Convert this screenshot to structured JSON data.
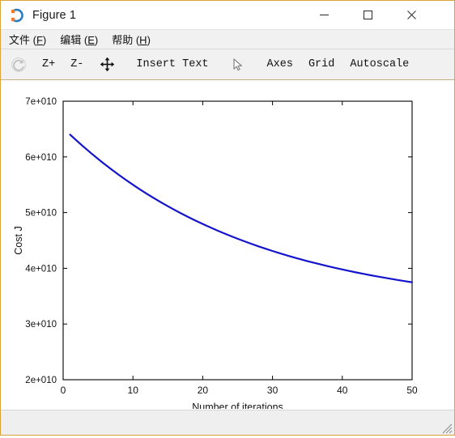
{
  "window": {
    "title": "Figure 1",
    "icon": "octave-logo-icon",
    "border_color": "#dba33a",
    "controls": {
      "minimize": "–",
      "maximize": "□",
      "close": "✕"
    }
  },
  "menubar": {
    "items": [
      {
        "label": "文件 (F)",
        "text": "文件 (",
        "accel": "F",
        "tail": ")",
        "name": "menu-file"
      },
      {
        "label": "编辑 (E)",
        "text": "编辑 (",
        "accel": "E",
        "tail": ")",
        "name": "menu-edit"
      },
      {
        "label": "帮助 (H)",
        "text": "帮助 (",
        "accel": "H",
        "tail": ")",
        "name": "menu-help"
      }
    ]
  },
  "toolbar": {
    "autoscale_icon": "reset-rotate-icon",
    "zoom_in": "Z+",
    "zoom_out": "Z-",
    "pan_icon": "pan-move-icon",
    "insert_text": "Insert Text",
    "select_icon": "cursor-pointer-icon",
    "axes": "Axes",
    "grid": "Grid",
    "autoscale": "Autoscale"
  },
  "chart_data": {
    "type": "line",
    "title": "",
    "xlabel": "Number of iterations",
    "ylabel": "Cost J",
    "xlim": [
      0,
      50
    ],
    "ylim": [
      20000000000,
      70000000000
    ],
    "xticks": [
      0,
      10,
      20,
      30,
      40,
      50
    ],
    "xticklabels": [
      "0",
      "10",
      "20",
      "30",
      "40",
      "50"
    ],
    "yticks": [
      20000000000,
      30000000000,
      40000000000,
      50000000000,
      60000000000,
      70000000000
    ],
    "yticklabels": [
      "2e+010",
      "3e+010",
      "4e+010",
      "5e+010",
      "6e+010",
      "7e+010"
    ],
    "grid": false,
    "legend": null,
    "series": [
      {
        "name": "Cost J",
        "color": "#1414cc",
        "linewidth": 2.2,
        "x": [
          1,
          2,
          3,
          4,
          5,
          6,
          7,
          8,
          9,
          10,
          11,
          12,
          13,
          14,
          15,
          16,
          17,
          18,
          19,
          20,
          21,
          22,
          23,
          24,
          25,
          26,
          27,
          28,
          29,
          30,
          31,
          32,
          33,
          34,
          35,
          36,
          37,
          38,
          39,
          40,
          41,
          42,
          43,
          44,
          45,
          46,
          47,
          48,
          49,
          50
        ],
        "y": [
          64000000000,
          62850000000,
          61740000000,
          60670000000,
          59640000000,
          58640000000,
          57680000000,
          56750000000,
          55860000000,
          55000000000,
          54170000000,
          53370000000,
          52600000000,
          51860000000,
          51150000000,
          50460000000,
          49800000000,
          49160000000,
          48550000000,
          47960000000,
          47390000000,
          46840000000,
          46310000000,
          45800000000,
          45310000000,
          44840000000,
          44380000000,
          43940000000,
          43520000000,
          43110000000,
          42720000000,
          42340000000,
          41980000000,
          41630000000,
          41290000000,
          40970000000,
          40660000000,
          40360000000,
          40070000000,
          39790000000,
          39520000000,
          39260000000,
          39010000000,
          38770000000,
          38540000000,
          38320000000,
          38100000000,
          37890000000,
          37690000000,
          37500000000
        ]
      }
    ]
  },
  "statusbar": {
    "text": "",
    "resize_grip": "resize-grip-icon"
  }
}
